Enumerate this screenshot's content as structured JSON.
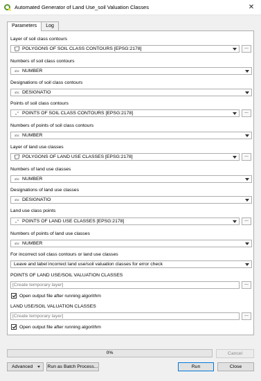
{
  "window": {
    "title": "Automated Generator of Land Use_soil Valuation Classes",
    "close_glyph": "✕"
  },
  "tabs": [
    {
      "label": "Parameters",
      "active": true
    },
    {
      "label": "Log",
      "active": false
    }
  ],
  "params": [
    {
      "label": "Layer of soil class contours",
      "value": "POLYGONS OF SOIL CLASS CONTOURS [EPSG:2178]",
      "icon": "polygon-layer-icon",
      "browse": "..."
    },
    {
      "label": "Numbers of soil class contours",
      "value": "NUMBER",
      "icon": "text-field-icon",
      "icon_text": "abc"
    },
    {
      "label": "Designations of soil class contours",
      "value": "DESIGNATIO",
      "icon": "text-field-icon",
      "icon_text": "abc"
    },
    {
      "label": "Points of soil class contours",
      "value": "POINTS OF SOIL CLASS CONTOURS [EPSG:2178]",
      "icon": "point-layer-icon",
      "browse": "..."
    },
    {
      "label": "Numbers of points of soil class contours",
      "value": "NUMBER",
      "icon": "text-field-icon",
      "icon_text": "abc"
    },
    {
      "label": "Layer of land use classes",
      "value": "POLYGONS OF LAND USE CLASSES [EPSG:2178]",
      "icon": "polygon-layer-icon",
      "browse": "..."
    },
    {
      "label": "Numbers of land use classes",
      "value": "NUMBER",
      "icon": "text-field-icon",
      "icon_text": "abc"
    },
    {
      "label": "Designations of land use classes",
      "value": "DESIGNATIO",
      "icon": "text-field-icon",
      "icon_text": "abc"
    },
    {
      "label": "Land use class points",
      "value": "POINTS OF LAND USE CLASSES [EPSG:2178]",
      "icon": "point-layer-icon",
      "browse": "..."
    },
    {
      "label": "Numbers of points of land use classes",
      "value": "NUMBER",
      "icon": "text-field-icon",
      "icon_text": "abc"
    },
    {
      "label": "For incorrect soil class contours or land use classes",
      "value": "Leave and label incorrect land use/soil valuation classes for error check"
    }
  ],
  "outputs": [
    {
      "label": "POINTS OF LAND USE/SOIL VALUATION CLASSES",
      "placeholder": "[Create temporary layer]",
      "browse": "...",
      "checkbox_label": "Open output file after running algorithm",
      "checked": true
    },
    {
      "label": "LAND USE/SOIL VALUATION CLASSES",
      "placeholder": "[Create temporary layer]",
      "browse": "...",
      "checkbox_label": "Open output file after running algorithm",
      "checked": true
    }
  ],
  "progress": {
    "text": "0%",
    "value": 0
  },
  "buttons": {
    "cancel": "Cancel",
    "advanced": "Advanced",
    "batch": "Run as Batch Process...",
    "run": "Run",
    "close": "Close"
  },
  "colors": {
    "qgis_green": "#589632",
    "qgis_yellow": "#f0e130",
    "progress_fill": "#06b025",
    "focus_blue": "#0078d7"
  }
}
